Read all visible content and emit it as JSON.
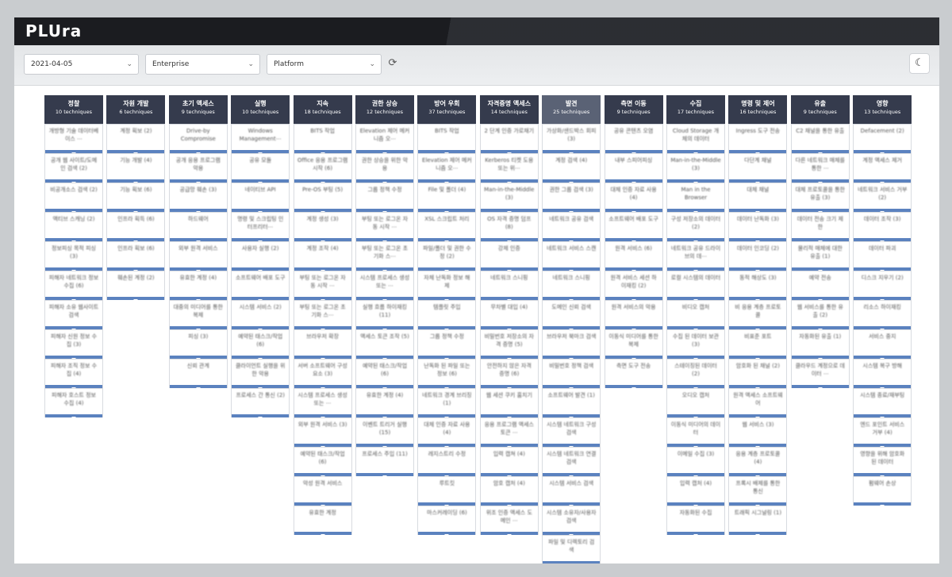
{
  "app": {
    "logo": "PLUra"
  },
  "toolbar": {
    "date": "2021-04-05",
    "env": "Enterprise",
    "platform": "Platform",
    "refresh_icon": "refresh-icon",
    "theme_icon": "moon-icon"
  },
  "columns": [
    {
      "title": "정찰",
      "count": "10 techniques",
      "cells": [
        "개방형 기술 데이터베이스 ⋯",
        "공개 웹 사이트/도메인 검색 (2)",
        "비공개소스 검색 (2)",
        "액티브 스캐닝 (2)",
        "정보피싱 목적 피싱 (3)",
        "피해자 네트워크 정보 수집 (6)",
        "피해자 소유 웹사이트 검색",
        "피해자 신원 정보 수집 (3)",
        "피해자 조직 정보 수집 (4)",
        "피해자 호스트 정보 수집 (4)"
      ]
    },
    {
      "title": "자원 개발",
      "count": "6 techniques",
      "cells": [
        "계정 획보 (2)",
        "기능 개발 (4)",
        "기능 획보 (6)",
        "인프라 획득 (6)",
        "인프라 획보 (6)",
        "훼손된 계정 (2)"
      ]
    },
    {
      "title": "초기 액세스",
      "count": "9 techniques",
      "cells": [
        "Drive-by Compromise",
        "공개 응용 프로그램 악용",
        "공급망 훼손 (3)",
        "하드웨어",
        "외부 원격 서비스",
        "유효한 계정 (4)",
        "대중의 미디어를 통한 복제",
        "피싱 (3)",
        "신뢰 관계"
      ]
    },
    {
      "title": "실행",
      "count": "10 techniques",
      "cells": [
        "Windows Management⋯",
        "공유 모듈",
        "네이티브 API",
        "명령 및 스크립팅 인터프리터⋯",
        "사용자 실행 (2)",
        "소프트웨어 배포 도구",
        "시스템 서비스 (2)",
        "예약된 태스크/작업 (6)",
        "클라이언트 실행을 위한 악용",
        "프로세스 간 통신 (2)"
      ]
    },
    {
      "title": "지속",
      "count": "18 techniques",
      "cells": [
        "BITS 작업",
        "Office 응용 프로그램 시작 (6)",
        "Pre-OS 부팅 (5)",
        "계정 생성 (3)",
        "계정 조작 (4)",
        "부팅 또는 로그온 자동 시작 ⋯",
        "부팅 또는 로그온 초기화 스⋯",
        "브라우저 확장",
        "서버 소프트웨어 구성요소 (3)",
        "시스템 프로세스 생성 또는 ⋯",
        "외부 원격 서비스 (3)",
        "예약된 태스크/작업 (6)",
        "악성 원격 서비스",
        "유효한 계정"
      ]
    },
    {
      "title": "권한 상승",
      "count": "12 techniques",
      "cells": [
        "Elevation 제어 메커니즘 오⋯",
        "권한 상승을 위한 악용",
        "그룹 정책 수정",
        "부팅 또는 로그온 자동 시작 ⋯",
        "부팅 또는 로그온 초기화 스⋯",
        "시스템 프로세스 생성 또는 ⋯",
        "실행 흐름 하이재킹 (11)",
        "액세스 토큰 조작 (5)",
        "예약된 태스크/작업 (6)",
        "유효한 계정 (4)",
        "이벤트 트리거 실행 (15)",
        "프로세스 주입 (11)"
      ]
    },
    {
      "title": "방어 우회",
      "count": "37 techniques",
      "cells": [
        "BITS 작업",
        "Elevation 제어 메커니즘 오⋯",
        "File 및 폴더 (4)",
        "XSL 스크립트 처리",
        "파일/폴더 및 권한 수정 (2)",
        "자체 난독화 정보 해제",
        "템플릿 주입",
        "그룹 정책 수정",
        "난독화 된 파일 또는 정보 (6)",
        "네트워크 경계 브리징 (1)",
        "대체 인증 자료 사용 (4)",
        "레지스트리 수정",
        "루트킷",
        "마스커레이딩 (6)"
      ]
    },
    {
      "title": "자격증명 액세스",
      "count": "14 techniques",
      "cells": [
        "2 단계 인증 가로채기",
        "Kerberos 티켓 도용 또는 위⋯",
        "Man-in-the-Middle (3)",
        "OS 자격 증명 덤프 (8)",
        "강제 인증",
        "네트워크 스니핑",
        "무차별 대입 (4)",
        "비밀번호 저장소의 자격 증명 (5)",
        "안전하지 않은 자격 증명 (6)",
        "웹 세션 쿠키 훔치기",
        "응용 프로그램 액세스 토큰 ⋯",
        "입력 캡쳐 (4)",
        "암호 캡처 (4)",
        "위조 인증 액세스 도메인 ⋯"
      ]
    },
    {
      "title": "발견",
      "count": "25 techniques",
      "light": true,
      "cells": [
        "가상화/샌드박스 회피 (3)",
        "계정 검색 (4)",
        "권한 그룹 검색 (3)",
        "네트워크 공유 검색",
        "네트워크 서비스 스캔",
        "네트워크 스니핑",
        "도메인 신뢰 검색",
        "브라우저 북마크 검색",
        "비밀번호 정책 검색",
        "소프트웨어 발견 (1)",
        "시스템 네트워크 구성 검색",
        "시스템 네트워크 연결 검색",
        "시스템 서비스 검색",
        "시스템 소유자/사용자 검색",
        "파일 및 디렉토리 검색"
      ]
    },
    {
      "title": "측면 이동",
      "count": "9 techniques",
      "cells": [
        "공유 콘텐츠 오염",
        "내부 스피어피싱",
        "대체 인증 자료 사용 (4)",
        "소프트웨어 배포 도구",
        "원격 서비스 (6)",
        "원격 서비스 세션 하이재킹 (2)",
        "원격 서비스의 악용",
        "이동식 미디어를 통한 복제",
        "측면 도구 전송"
      ]
    },
    {
      "title": "수집",
      "count": "17 techniques",
      "cells": [
        "Cloud Storage 개체의 데이터",
        "Man-in-the-Middle (3)",
        "Man in the Browser",
        "구성 저장소의 데이터 (2)",
        "네트워크 공유 드라이브의 데⋯",
        "로컬 시스템의 데이터",
        "비디오 캡처",
        "수집 된 데이터 보관 (3)",
        "스테이징된 데이터 (2)",
        "오디오 캡처",
        "이동식 미디어의 데이터",
        "이메일 수집 (3)",
        "입력 캡처 (4)",
        "자동화된 수집"
      ]
    },
    {
      "title": "명령 및 제어",
      "count": "16 techniques",
      "cells": [
        "Ingress 도구 전송",
        "다단계 채널",
        "대체 채널",
        "데이터 난독화 (3)",
        "데이터 인코딩 (2)",
        "동적 해상도 (3)",
        "비 응용 계층 프로토콜",
        "비표준 포트",
        "암호화 된 채널 (2)",
        "원격 액세스 소프트웨어",
        "웹 서비스 (3)",
        "응용 계층 프로토콜 (4)",
        "프록시 배제를 통한 통신",
        "트래픽 시그널링 (1)"
      ]
    },
    {
      "title": "유출",
      "count": "9 techniques",
      "cells": [
        "C2 채널을 통한 유출",
        "다른 네트워크 매체를 통한 ⋯",
        "대체 프로토콜을 통한 유출 (3)",
        "데이터 전송 크기 제한",
        "물리적 매체에 대한 유출 (1)",
        "예약 전송",
        "웹 서비스를 통한 유출 (2)",
        "자동화된 유출 (1)",
        "클라우드 계정으로 데이터 ⋯"
      ]
    },
    {
      "title": "영향",
      "count": "13 techniques",
      "cells": [
        "Defacement (2)",
        "계정 액세스 제거",
        "네트워크 서비스 거부 (2)",
        "데이터 조작 (3)",
        "데이터 파괴",
        "디스크 지우기 (2)",
        "리소스 하이재킹",
        "서비스 중지",
        "시스템 복구 방해",
        "시스템 종료/재부팅",
        "엔드 포인트 서비스 거부 (4)",
        "영향을 위해 암호화 된 데이터",
        "펌웨어 손상"
      ]
    }
  ]
}
